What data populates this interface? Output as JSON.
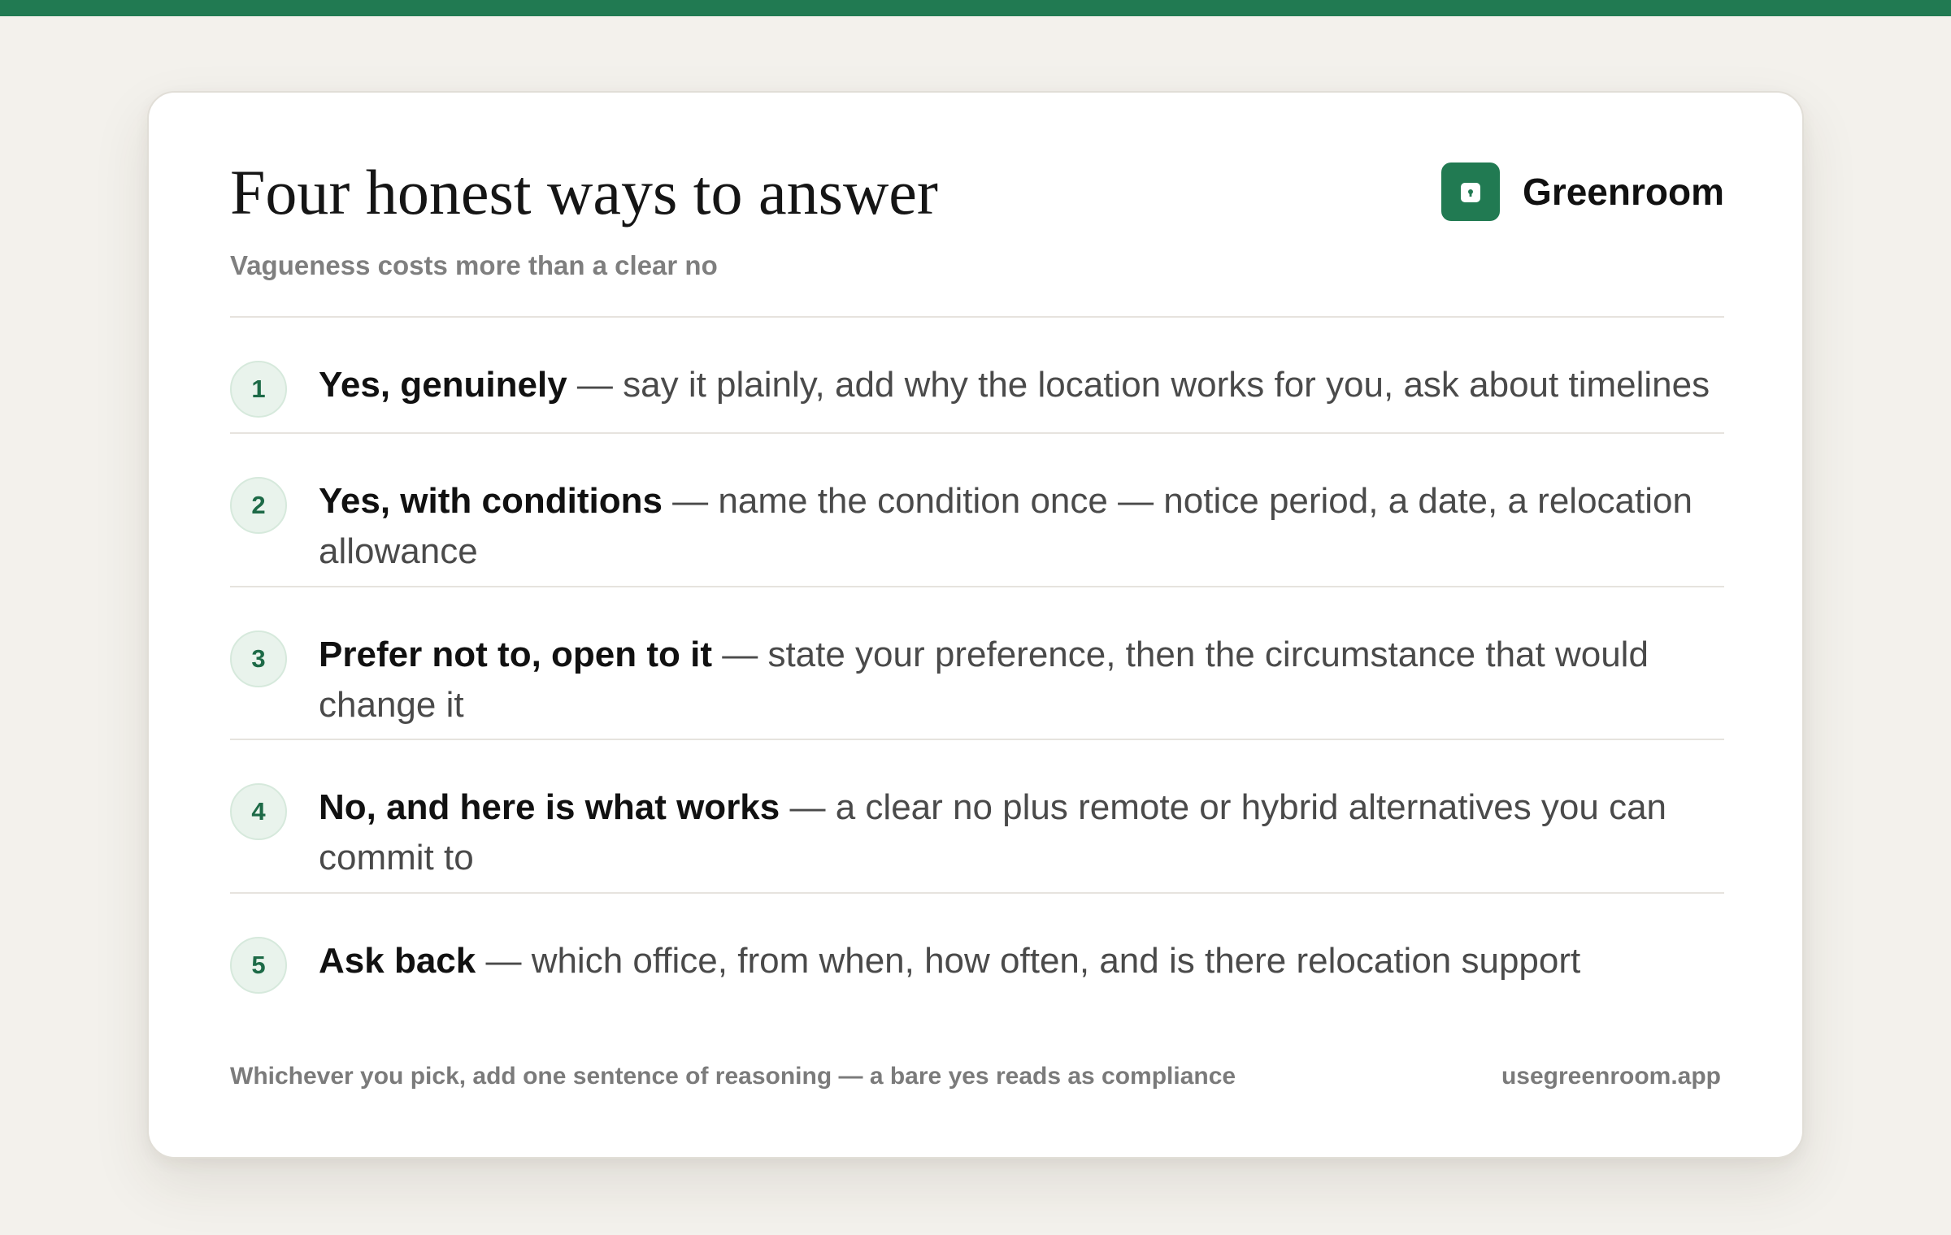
{
  "title": "Four honest ways to answer",
  "subtitle": "Vagueness costs more than a clear no",
  "brand": {
    "name": "Greenroom",
    "icon": "lock-icon",
    "color": "#217a52"
  },
  "items": [
    {
      "number": "1",
      "lead": "Yes, genuinely",
      "separator": " — ",
      "detail": "say it plainly, add why the location works for you, ask about timelines"
    },
    {
      "number": "2",
      "lead": "Yes, with conditions",
      "separator": " — ",
      "detail": "name the condition once — notice period, a date, a relocation allowance"
    },
    {
      "number": "3",
      "lead": "Prefer not to, open to it",
      "separator": " — ",
      "detail": "state your preference, then the circumstance that would change it"
    },
    {
      "number": "4",
      "lead": "No, and here is what works",
      "separator": " — ",
      "detail": "a clear no plus remote or hybrid alternatives you can commit to"
    },
    {
      "number": "5",
      "lead": "Ask back",
      "separator": " — ",
      "detail": "which office, from when, how often, and is there relocation support"
    }
  ],
  "footer": {
    "note": "Whichever you pick, add one sentence of reasoning — a bare yes reads as compliance",
    "url": "usegreenroom.app"
  }
}
